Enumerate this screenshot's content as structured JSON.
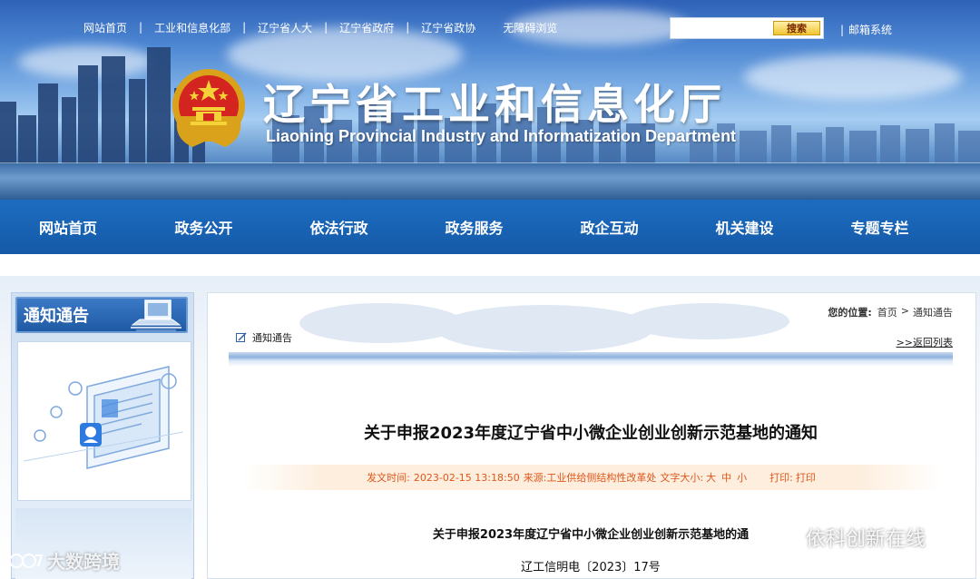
{
  "colors": {
    "nav_bg": "#155aa8",
    "accent_orange": "#e0561d",
    "search_btn": "#f2c532"
  },
  "header": {
    "top_links": [
      "网站首页",
      "工业和信息化部",
      "辽宁省人大",
      "辽宁省政府",
      "辽宁省政协",
      "无障碍浏览"
    ],
    "search": {
      "placeholder": "",
      "button_label": "搜索"
    },
    "mail_link": "邮箱系统",
    "site_title": "辽宁省工业和信息化厅",
    "site_subtitle": "Liaoning Provincial Industry and Informatization Department"
  },
  "nav": {
    "items": [
      "网站首页",
      "政务公开",
      "依法行政",
      "政务服务",
      "政企互动",
      "机关建设",
      "专题专栏"
    ]
  },
  "sidebar": {
    "title": "通知通告"
  },
  "breadcrumb": {
    "label": "您的位置:",
    "items": [
      "首页",
      "通知通告"
    ],
    "separator": ">"
  },
  "section": {
    "tag": "通知通告",
    "back_link": ">>返回列表"
  },
  "article": {
    "title": "关于申报2023年度辽宁省中小微企业创业创新示范基地的通知",
    "meta": {
      "time_label": "发文时间:",
      "time": "2023-02-15 13:18:50",
      "source_label": "来源:",
      "source": "工业供给侧结构性改革处",
      "font_label": "文字大小:",
      "sizes": [
        "大",
        "中",
        "小"
      ],
      "print_label": "打印:",
      "print": "打印"
    },
    "doc_heading": "关于申报2023年度辽宁省中小微企业创业创新示范基地的通",
    "doc_number": "辽工信明电〔2023〕17号"
  },
  "watermarks": {
    "left": "大数跨境",
    "right": "依科创新在线"
  }
}
